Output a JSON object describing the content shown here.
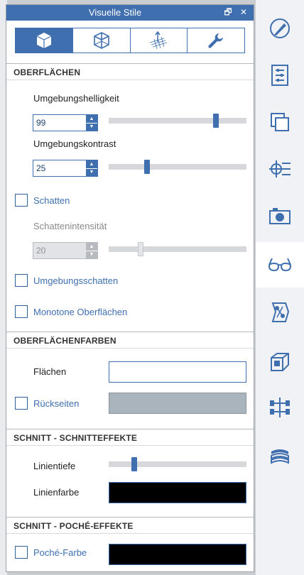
{
  "panel": {
    "title": "Visuelle Stile",
    "restore_label": "🗗",
    "close_label": "✕"
  },
  "tabs": [
    {
      "icon": "cube-icon",
      "active": true
    },
    {
      "icon": "wireframe-cube-icon",
      "active": false
    },
    {
      "icon": "axes-grid-icon",
      "active": false
    },
    {
      "icon": "wrench-icon",
      "active": false
    }
  ],
  "oberflaechen": {
    "header": "OBERFLÄCHEN",
    "helligkeit_label": "Umgebungshelligkeit",
    "helligkeit_value": "99",
    "helligkeit_slider": 0.79,
    "kontrast_label": "Umgebungskontrast",
    "kontrast_value": "25",
    "kontrast_slider": 0.27,
    "schatten_label": "Schatten",
    "schatten_checked": false,
    "schattenintensitaet_label": "Schattenintensität",
    "schattenintensitaet_value": "20",
    "schattenintensitaet_slider": 0.22,
    "umgebungsschatten_label": "Umgebungsschatten",
    "umgebungsschatten_checked": false,
    "monotone_label": "Monotone Oberflächen",
    "monotone_checked": false
  },
  "oberflaechenfarben": {
    "header": "OBERFLÄCHENFARBEN",
    "flaechen_label": "Flächen",
    "flaechen_color": "#ffffff",
    "rueckseiten_label": "Rückseiten",
    "rueckseiten_checked": false,
    "rueckseiten_color": "#aab4bd"
  },
  "schnitteffekte": {
    "header": "SCHNITT - SCHNITTEFFEKTE",
    "linientiefe_label": "Linientiefe",
    "linientiefe_slider": 0.17,
    "linienfarbe_label": "Linienfarbe",
    "linienfarbe_color": "#000000"
  },
  "poche": {
    "header": "SCHNITT - POCHÉ-EFFEKTE",
    "poche_label": "Poché-Farbe",
    "poche_checked": false,
    "poche_color": "#000000"
  },
  "sidebar": [
    {
      "icon": "brush-icon",
      "active": false
    },
    {
      "icon": "properties-list-icon",
      "active": false
    },
    {
      "icon": "layers-icon",
      "active": false
    },
    {
      "icon": "section-planes-icon",
      "active": false
    },
    {
      "icon": "camera-icon",
      "active": false
    },
    {
      "icon": "glasses-icon",
      "active": true
    },
    {
      "icon": "components-icon",
      "active": false
    },
    {
      "icon": "box-3d-icon",
      "active": false
    },
    {
      "icon": "hierarchy-tree-icon",
      "active": false
    },
    {
      "icon": "stacked-sheets-icon",
      "active": false
    }
  ],
  "colors": {
    "accent": "#3f6fae",
    "header_bg": "#3f6fae"
  }
}
